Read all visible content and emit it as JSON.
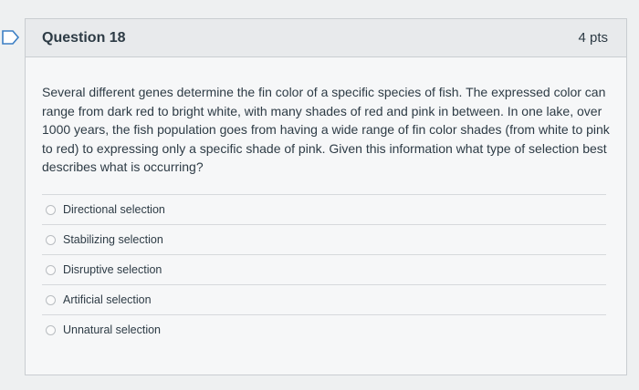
{
  "question": {
    "title": "Question 18",
    "points": "4 pts",
    "text": "Several different genes determine the fin color of a specific species of fish. The expressed color can range from dark red to bright white, with many shades of red and pink in between. In one lake, over 1000 years, the fish population goes from having a wide range of fin color shades (from white to pink to red) to expressing only a specific shade of pink. Given this information what type of selection best describes what is occurring?"
  },
  "answers": [
    {
      "label": "Directional selection"
    },
    {
      "label": "Stabilizing selection"
    },
    {
      "label": "Disruptive selection"
    },
    {
      "label": "Artificial selection"
    },
    {
      "label": "Unnatural selection"
    }
  ],
  "colors": {
    "accent": "#3b7fc4",
    "text": "#2d3b45",
    "header_bg": "#e8eaec"
  }
}
